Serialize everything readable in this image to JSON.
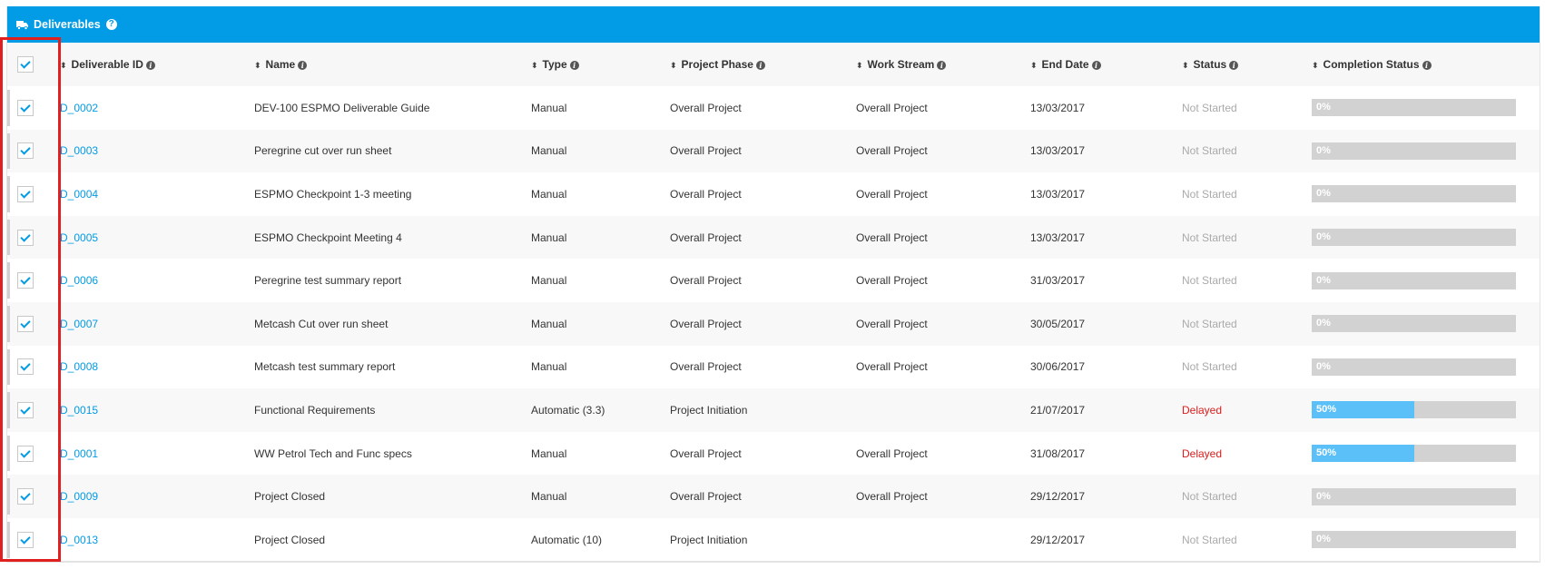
{
  "panel": {
    "title": "Deliverables"
  },
  "columns": [
    {
      "label": "Deliverable ID"
    },
    {
      "label": "Name"
    },
    {
      "label": "Type"
    },
    {
      "label": "Project Phase"
    },
    {
      "label": "Work Stream"
    },
    {
      "label": "End Date"
    },
    {
      "label": "Status"
    },
    {
      "label": "Completion Status"
    }
  ],
  "rows": [
    {
      "id": "D_0002",
      "name": "DEV-100 ESPMO Deliverable Guide",
      "type": "Manual",
      "phase": "Overall Project",
      "stream": "Overall Project",
      "end": "13/03/2017",
      "status": "Not Started",
      "status_kind": "not-started",
      "completion": 0,
      "completion_label": "0%"
    },
    {
      "id": "D_0003",
      "name": "Peregrine cut over run sheet",
      "type": "Manual",
      "phase": "Overall Project",
      "stream": "Overall Project",
      "end": "13/03/2017",
      "status": "Not Started",
      "status_kind": "not-started",
      "completion": 0,
      "completion_label": "0%"
    },
    {
      "id": "D_0004",
      "name": "ESPMO Checkpoint 1-3 meeting",
      "type": "Manual",
      "phase": "Overall Project",
      "stream": "Overall Project",
      "end": "13/03/2017",
      "status": "Not Started",
      "status_kind": "not-started",
      "completion": 0,
      "completion_label": "0%"
    },
    {
      "id": "D_0005",
      "name": "ESPMO Checkpoint Meeting 4",
      "type": "Manual",
      "phase": "Overall Project",
      "stream": "Overall Project",
      "end": "13/03/2017",
      "status": "Not Started",
      "status_kind": "not-started",
      "completion": 0,
      "completion_label": "0%"
    },
    {
      "id": "D_0006",
      "name": "Peregrine test summary report",
      "type": "Manual",
      "phase": "Overall Project",
      "stream": "Overall Project",
      "end": "31/03/2017",
      "status": "Not Started",
      "status_kind": "not-started",
      "completion": 0,
      "completion_label": "0%"
    },
    {
      "id": "D_0007",
      "name": "Metcash Cut over run sheet",
      "type": "Manual",
      "phase": "Overall Project",
      "stream": "Overall Project",
      "end": "30/05/2017",
      "status": "Not Started",
      "status_kind": "not-started",
      "completion": 0,
      "completion_label": "0%"
    },
    {
      "id": "D_0008",
      "name": "Metcash test summary report",
      "type": "Manual",
      "phase": "Overall Project",
      "stream": "Overall Project",
      "end": "30/06/2017",
      "status": "Not Started",
      "status_kind": "not-started",
      "completion": 0,
      "completion_label": "0%"
    },
    {
      "id": "D_0015",
      "name": "Functional Requirements",
      "type": "Automatic (3.3)",
      "phase": "Project Initiation",
      "stream": "",
      "end": "21/07/2017",
      "status": "Delayed",
      "status_kind": "delayed",
      "completion": 50,
      "completion_label": "50%"
    },
    {
      "id": "D_0001",
      "name": "WW Petrol Tech and Func specs",
      "type": "Manual",
      "phase": "Overall Project",
      "stream": "Overall Project",
      "end": "31/08/2017",
      "status": "Delayed",
      "status_kind": "delayed",
      "completion": 50,
      "completion_label": "50%"
    },
    {
      "id": "D_0009",
      "name": "Project Closed",
      "type": "Manual",
      "phase": "Overall Project",
      "stream": "Overall Project",
      "end": "29/12/2017",
      "status": "Not Started",
      "status_kind": "not-started",
      "completion": 0,
      "completion_label": "0%"
    },
    {
      "id": "D_0013",
      "name": "Project Closed",
      "type": "Automatic (10)",
      "phase": "Project Initiation",
      "stream": "",
      "end": "29/12/2017",
      "status": "Not Started",
      "status_kind": "not-started",
      "completion": 0,
      "completion_label": "0%"
    }
  ]
}
